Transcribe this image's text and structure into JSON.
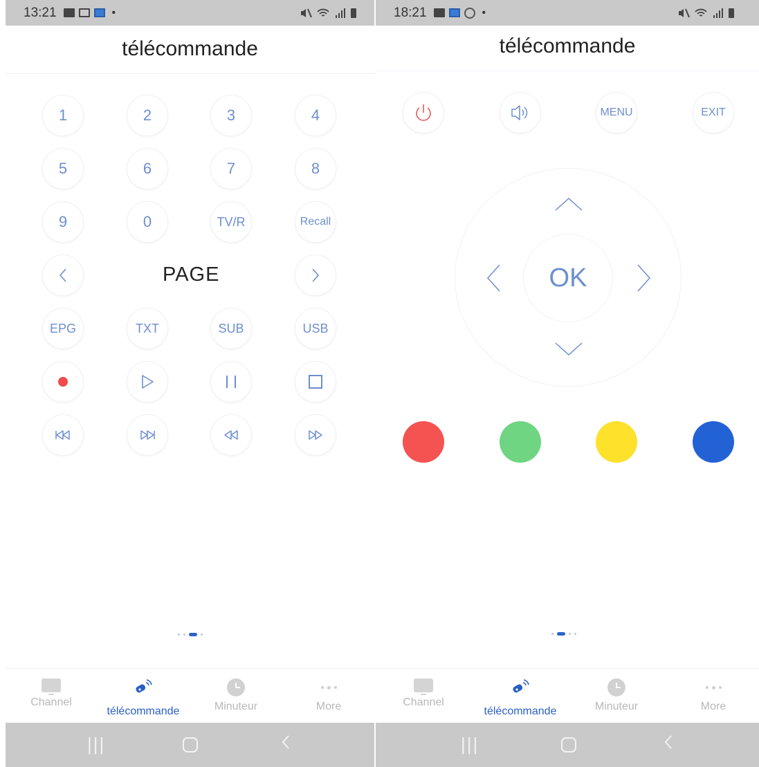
{
  "left": {
    "status_time": "13:21",
    "title": "télécommande",
    "keypad": [
      "1",
      "2",
      "3",
      "4",
      "5",
      "6",
      "7",
      "8",
      "9",
      "0",
      "TV/R",
      "Recall"
    ],
    "page_label": "PAGE",
    "function_keys": [
      "EPG",
      "TXT",
      "SUB",
      "USB"
    ]
  },
  "right": {
    "status_time": "18:21",
    "title": "télécommande",
    "menu_label": "MENU",
    "exit_label": "EXIT",
    "ok_label": "OK",
    "color_buttons": [
      "#f55252",
      "#6fd583",
      "#fde12b",
      "#2362d5"
    ]
  },
  "tabs": [
    "Channel",
    "télécommande",
    "Minuteur",
    "More"
  ],
  "active_tab": "télécommande",
  "colors": {
    "accent": "#2a5fc4",
    "button_text": "#6c8fcf",
    "record": "#f14b4b",
    "power": "#e35b5b"
  },
  "icons": [
    "power-icon",
    "volume-icon",
    "record-icon",
    "play-icon",
    "pause-icon",
    "stop-icon",
    "skip-back-icon",
    "skip-forward-icon",
    "rewind-icon",
    "fast-forward-icon",
    "tv-icon",
    "remote-icon",
    "clock-icon",
    "more-icon"
  ]
}
